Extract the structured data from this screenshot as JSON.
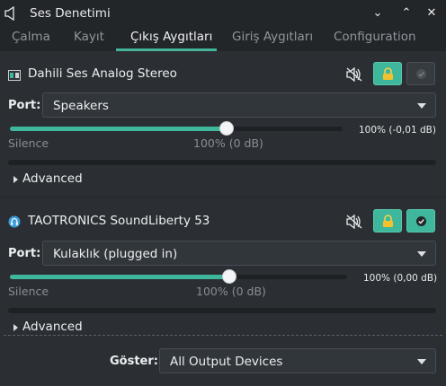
{
  "window": {
    "title": "Ses Denetimi",
    "buttons": [
      "⌄",
      "⌃",
      "✕"
    ]
  },
  "tabs": [
    {
      "label": "Çalma",
      "active": false
    },
    {
      "label": "Kayıt",
      "active": false
    },
    {
      "label": "Çıkış Aygıtları",
      "active": true
    },
    {
      "label": "Giriş Aygıtları",
      "active": false
    },
    {
      "label": "Configuration",
      "active": false
    }
  ],
  "devices": [
    {
      "name": "Dahili Ses Analog Stereo",
      "icon": "sound-card-icon",
      "port_label": "Port:",
      "port_value": "Speakers",
      "volume_percent": 100,
      "volume_readout": "100% (-0,01 dB)",
      "silence_label": "Silence",
      "mark_label": "100% (0 dB)",
      "advanced_label": "Advanced",
      "default_checked": false
    },
    {
      "name": "TAOTRONICS SoundLiberty 53",
      "icon": "bluetooth-headset-icon",
      "port_label": "Port:",
      "port_value": "Kulaklık (plugged in)",
      "volume_percent": 100,
      "volume_readout": "100% (0,00 dB)",
      "silence_label": "Silence",
      "mark_label": "100% (0 dB)",
      "advanced_label": "Advanced",
      "default_checked": true
    }
  ],
  "footer": {
    "show_label": "Göster:",
    "show_value": "All Output Devices"
  },
  "colors": {
    "accent": "#3fb79c",
    "background": "#2b2f33",
    "titlebar": "#232629"
  }
}
